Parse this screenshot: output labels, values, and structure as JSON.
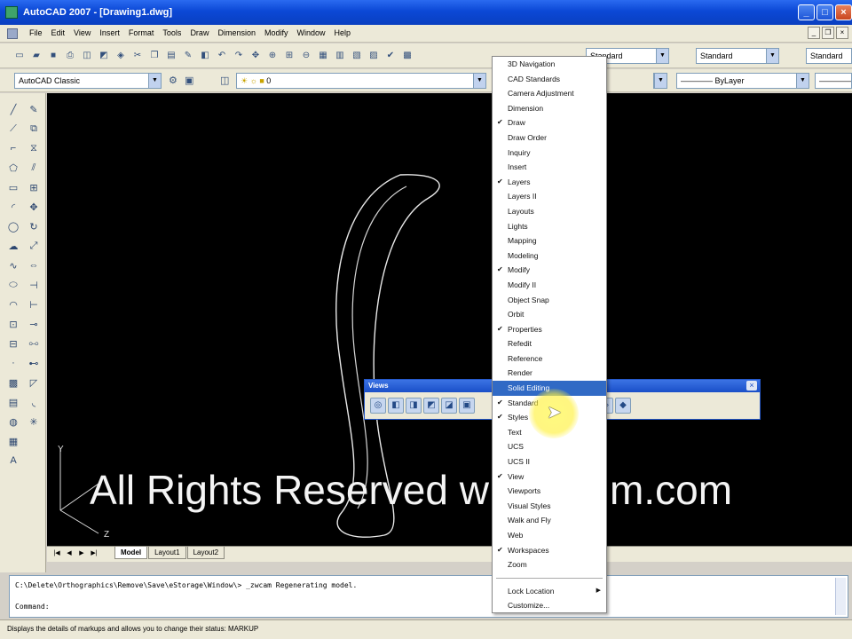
{
  "window": {
    "title": "AutoCAD 2007 - [Drawing1.dwg]",
    "min": "_",
    "max": "□",
    "close": "×"
  },
  "menubar": {
    "items": [
      "File",
      "Edit",
      "View",
      "Insert",
      "Format",
      "Tools",
      "Draw",
      "Dimension",
      "Modify",
      "Window",
      "Help"
    ]
  },
  "toolbar1": {
    "text_style": "Standard",
    "dim_style": "Standard",
    "table_style": "Standard"
  },
  "toolbar2": {
    "workspace": "AutoCAD Classic",
    "layer": "0",
    "linetype": "ByLayer"
  },
  "floating_toolbar": {
    "title": "Views"
  },
  "context_menu": {
    "items": [
      {
        "label": "3D Navigation",
        "checked": false
      },
      {
        "label": "CAD Standards",
        "checked": false
      },
      {
        "label": "Camera Adjustment",
        "checked": false
      },
      {
        "label": "Dimension",
        "checked": false
      },
      {
        "label": "Draw",
        "checked": true
      },
      {
        "label": "Draw Order",
        "checked": false
      },
      {
        "label": "Inquiry",
        "checked": false
      },
      {
        "label": "Insert",
        "checked": false
      },
      {
        "label": "Layers",
        "checked": true
      },
      {
        "label": "Layers II",
        "checked": false
      },
      {
        "label": "Layouts",
        "checked": false
      },
      {
        "label": "Lights",
        "checked": false
      },
      {
        "label": "Mapping",
        "checked": false
      },
      {
        "label": "Modeling",
        "checked": false
      },
      {
        "label": "Modify",
        "checked": true
      },
      {
        "label": "Modify II",
        "checked": false
      },
      {
        "label": "Object Snap",
        "checked": false
      },
      {
        "label": "Orbit",
        "checked": false
      },
      {
        "label": "Properties",
        "checked": true
      },
      {
        "label": "Refedit",
        "checked": false
      },
      {
        "label": "Reference",
        "checked": false
      },
      {
        "label": "Render",
        "checked": false
      },
      {
        "label": "Solid Editing",
        "checked": false,
        "highlighted": true
      },
      {
        "label": "Standard",
        "checked": true
      },
      {
        "label": "Styles",
        "checked": true
      },
      {
        "label": "Text",
        "checked": false
      },
      {
        "label": "UCS",
        "checked": false
      },
      {
        "label": "UCS II",
        "checked": false
      },
      {
        "label": "View",
        "checked": true
      },
      {
        "label": "Viewports",
        "checked": false
      },
      {
        "label": "Visual Styles",
        "checked": false
      },
      {
        "label": "Walk and Fly",
        "checked": false
      },
      {
        "label": "Web",
        "checked": false
      },
      {
        "label": "Workspaces",
        "checked": true
      },
      {
        "label": "Zoom",
        "checked": false
      }
    ],
    "footer": [
      {
        "label": "Lock Location",
        "submenu": true
      },
      {
        "label": "Customize...",
        "submenu": false
      }
    ]
  },
  "layout_tabs": {
    "tabs": [
      "Model",
      "Layout1",
      "Layout2"
    ]
  },
  "command_line": {
    "line1": "C:\\Delete\\Orthographics\\Remove\\Save\\eStorage\\Window\\> _zwcam Regenerating model.",
    "line2": "Command:"
  },
  "watermark": {
    "part1": "All Rights Reserved w",
    "part2": "ajim.com"
  },
  "statusbar": {
    "text": "Displays the details of markups and allows you to change their status: MARKUP"
  },
  "ucs": {
    "y_label": "Y",
    "z_label": "Z"
  },
  "colors": {
    "title_blue": "#0b48d6",
    "canvas": "#000000",
    "menu_highlight": "#316ac5"
  }
}
